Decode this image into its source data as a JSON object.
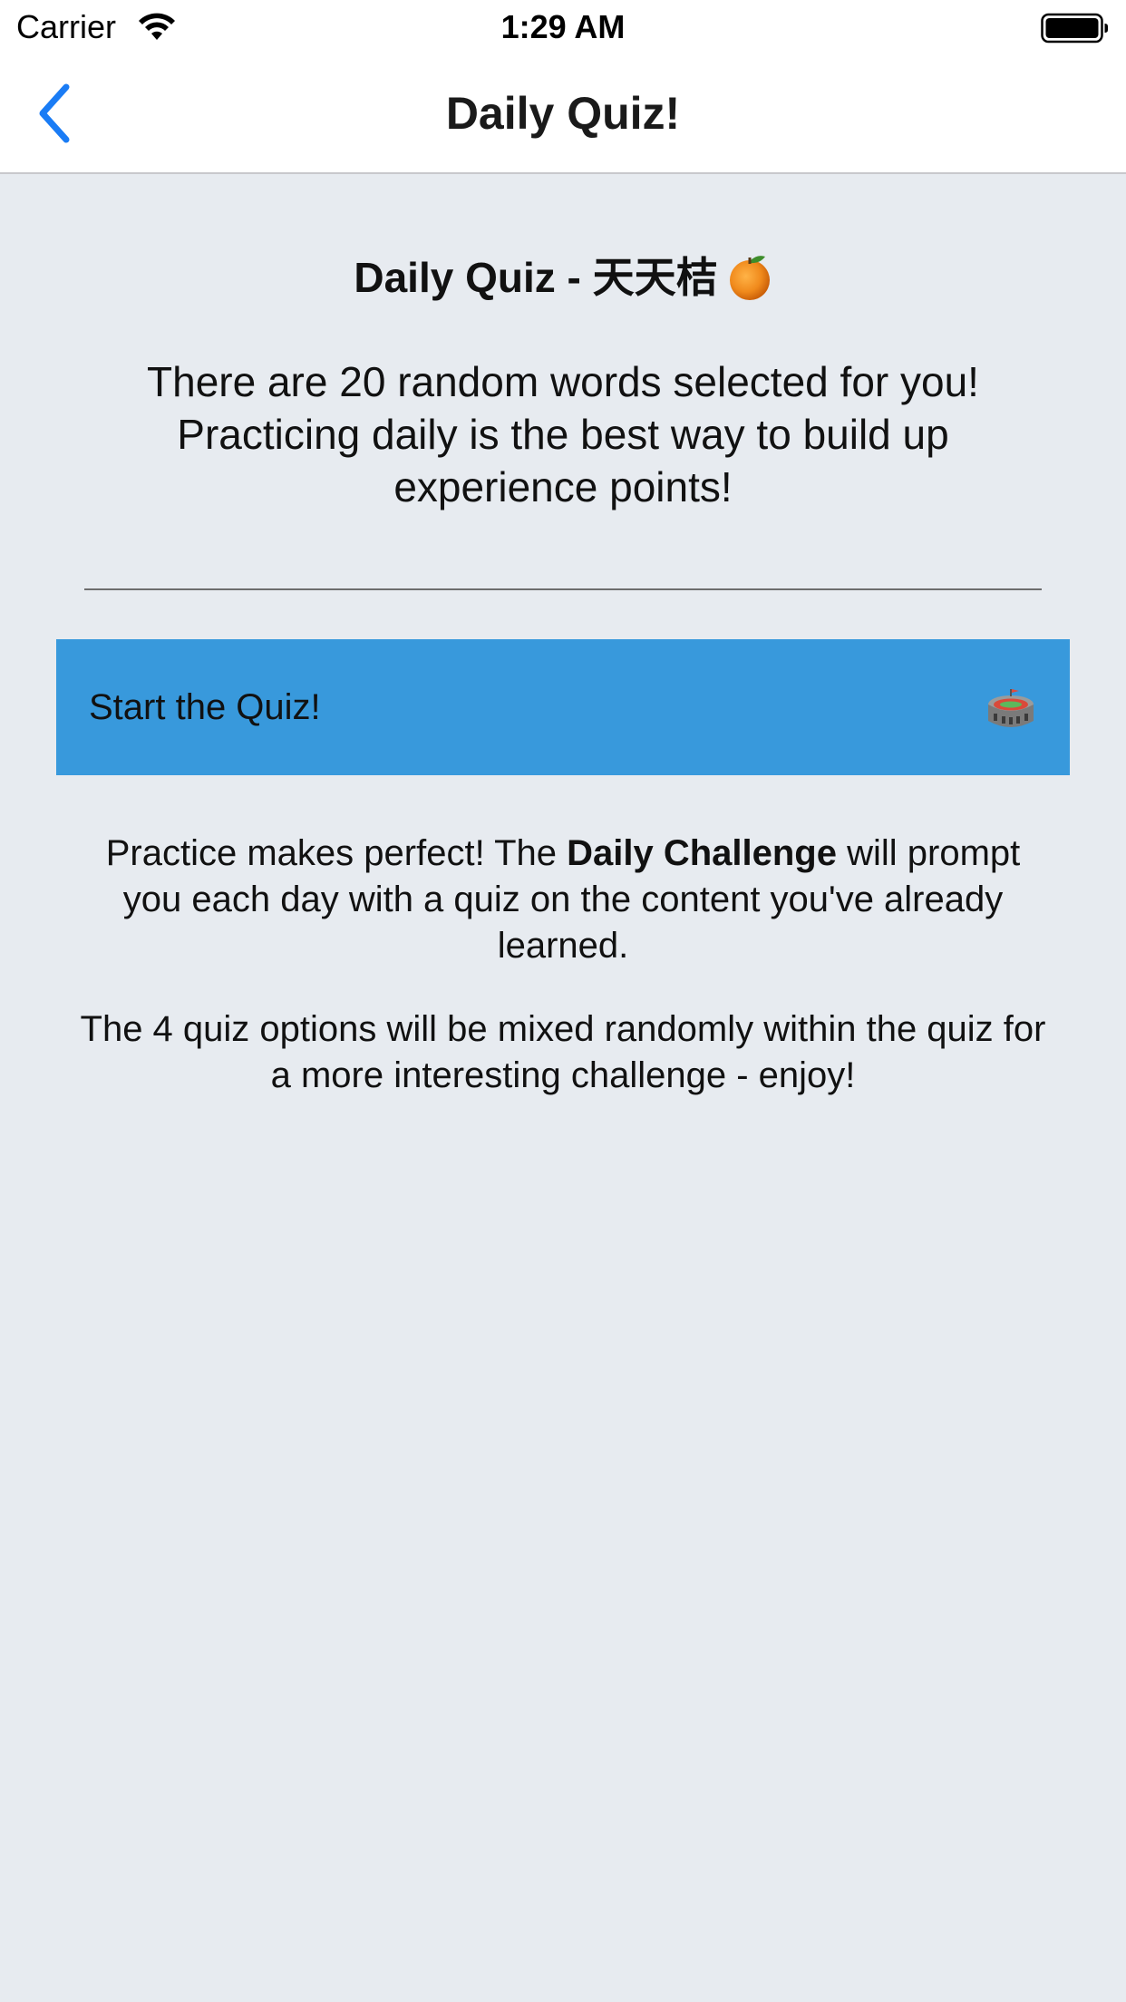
{
  "status_bar": {
    "carrier": "Carrier",
    "time": "1:29 AM"
  },
  "nav": {
    "title": "Daily Quiz!",
    "back_icon": "chevron-left-icon",
    "accent_color": "#1a7cf5"
  },
  "main": {
    "heading": "Daily Quiz - 天天桔",
    "heading_icon": "orange-icon",
    "intro": "There are 20 random words selected for you! Practicing daily is the best way to build up experience points!",
    "start_button": {
      "label": "Start the Quiz!",
      "icon": "stadium-icon",
      "color": "#3899dc"
    },
    "paragraph1": {
      "before": "Practice makes perfect! The ",
      "bold": "Daily Challenge",
      "after": " will prompt you each day with a quiz on the content you've already learned."
    },
    "paragraph2": "The 4 quiz options will be mixed randomly within the quiz for a more interesting challenge - enjoy!"
  },
  "background_color": "#e7ebf0"
}
